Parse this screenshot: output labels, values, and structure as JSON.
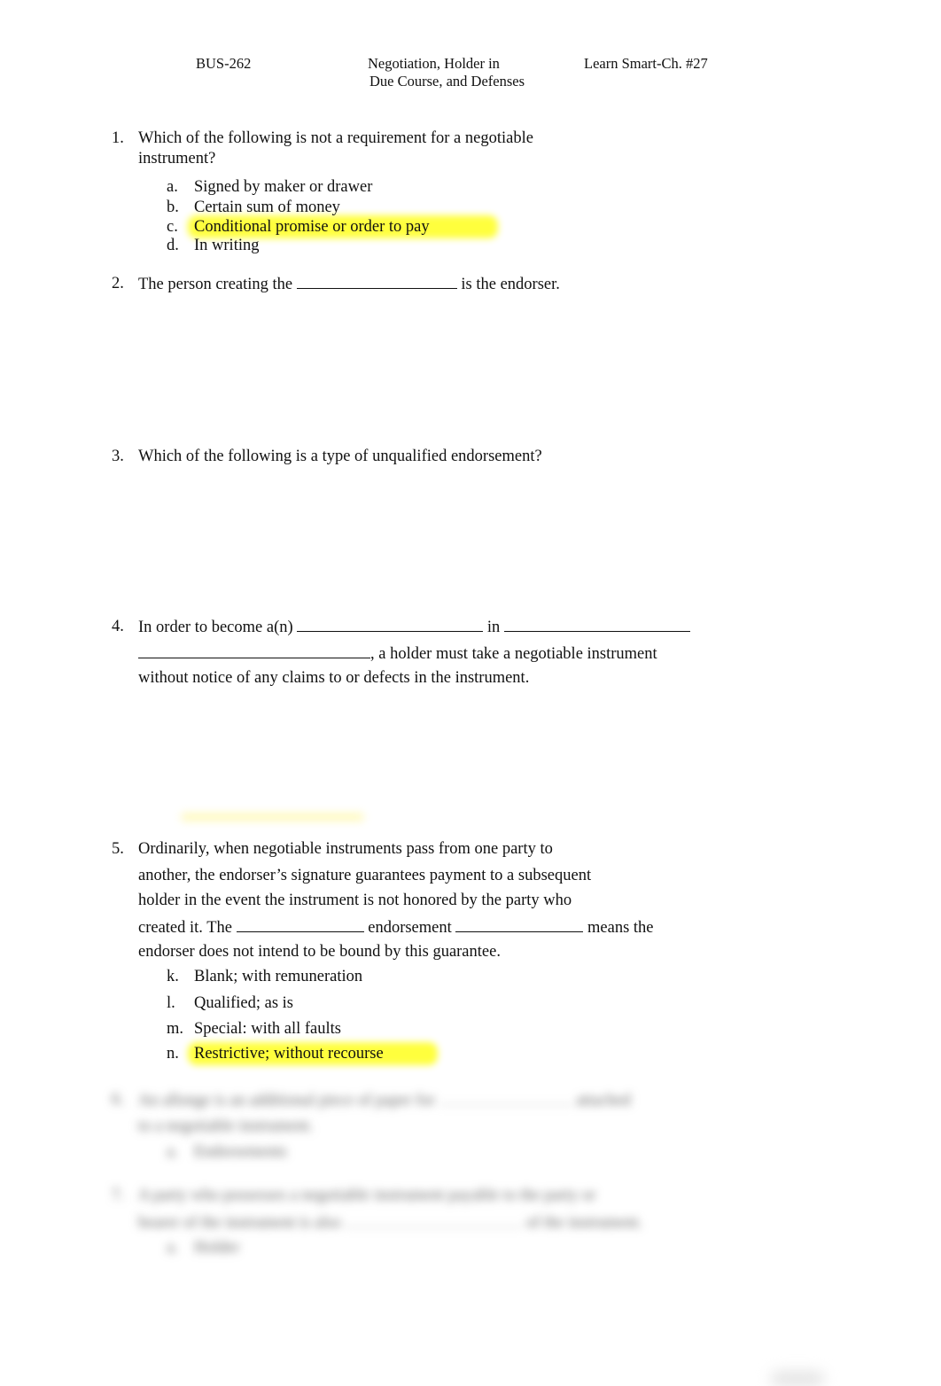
{
  "header": {
    "course": "BUS-262",
    "title_line1": "Negotiation, Holder in",
    "title_line2": "Due Course, and Defenses",
    "chapter": "Learn Smart-Ch. #27"
  },
  "questions": [
    {
      "number": "1.",
      "lines": [
        "Which of the following is not a requirement for a negotiable",
        "instrument?"
      ],
      "options": [
        {
          "letter": "a.",
          "text": "Signed by maker or drawer",
          "highlighted": false
        },
        {
          "letter": "b.",
          "text": "Certain sum of money",
          "highlighted": false
        },
        {
          "letter": "c.",
          "text": "Conditional promise or order to pay",
          "highlighted": true
        },
        {
          "letter": "d.",
          "text": "In writing",
          "highlighted": false
        }
      ]
    },
    {
      "number": "2.",
      "before": "The person creating the",
      "after": "is the endorser."
    },
    {
      "number": "3.",
      "text": "Which of the following is a type of unqualified endorsement?"
    },
    {
      "number": "4.",
      "part1": "In order to become a(n)",
      "part2": "in",
      "part3": ", a holder must take a negotiable instrument",
      "line3": "without notice of any claims to or defects in the instrument."
    },
    {
      "number": "5.",
      "lines": [
        "Ordinarily, when negotiable instruments pass from one party to",
        "another, the endorser’s signature guarantees payment to a subsequent",
        "holder in the event the instrument is not honored by the party who"
      ],
      "line4_a": "created it. The",
      "line4_b": "endorsement",
      "line4_c": "means the",
      "line5": "endorser does not intend to be bound by this guarantee.",
      "options": [
        {
          "letter": "k.",
          "text": "Blank; with remuneration",
          "highlighted": false
        },
        {
          "letter": "l.",
          "text": "Qualified; as is",
          "highlighted": false
        },
        {
          "letter": "m.",
          "text": "Special: with all faults",
          "highlighted": false
        },
        {
          "letter": "n.",
          "text": "Restrictive; without recourse",
          "highlighted": true
        }
      ]
    }
  ],
  "blurred": {
    "q6_number": "6.",
    "q6_line1": "An allonge is an additional piece of paper for",
    "q6_line1_end": "attached",
    "q6_line2": "to a negotiable instrument.",
    "q6_option_letter": "a.",
    "q6_option": "Endorsements",
    "q7_number": "7.",
    "q7_line1": "A party who possesses a negotiable instrument payable to the party or",
    "q7_line2": "bearer of the instrument is also",
    "q7_line2_end": "of the instrument.",
    "q7_option_letter": "a.",
    "q7_option": "Holder"
  },
  "colors": {
    "highlight": "#ffff33",
    "text": "#111111"
  }
}
